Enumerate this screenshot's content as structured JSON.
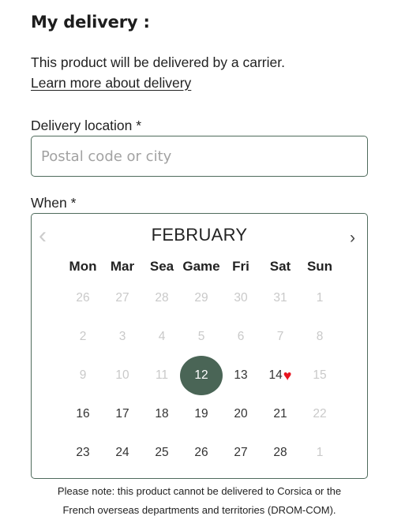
{
  "header": {
    "title": "My delivery :"
  },
  "intro": {
    "text": "This product will be delivered by a carrier.",
    "link": "Learn more about delivery"
  },
  "location": {
    "label": "Delivery location *",
    "placeholder": "Postal code or city",
    "value": ""
  },
  "when": {
    "label": "When *"
  },
  "calendar": {
    "month": "FEBRUARY",
    "prev_icon": "chevron-left-icon",
    "next_icon": "chevron-right-icon",
    "weekdays": [
      "Mon",
      "Mar",
      "Sea",
      "Game",
      "Fri",
      "Sat",
      "Sun"
    ],
    "weeks": [
      [
        {
          "d": "26",
          "s": "muted"
        },
        {
          "d": "27",
          "s": "muted"
        },
        {
          "d": "28",
          "s": "muted"
        },
        {
          "d": "29",
          "s": "muted"
        },
        {
          "d": "30",
          "s": "muted"
        },
        {
          "d": "31",
          "s": "muted"
        },
        {
          "d": "1",
          "s": "muted"
        }
      ],
      [
        {
          "d": "2",
          "s": "muted"
        },
        {
          "d": "3",
          "s": "muted"
        },
        {
          "d": "4",
          "s": "muted"
        },
        {
          "d": "5",
          "s": "muted"
        },
        {
          "d": "6",
          "s": "muted"
        },
        {
          "d": "7",
          "s": "muted"
        },
        {
          "d": "8",
          "s": "muted"
        }
      ],
      [
        {
          "d": "9",
          "s": "muted"
        },
        {
          "d": "10",
          "s": "muted"
        },
        {
          "d": "11",
          "s": "muted"
        },
        {
          "d": "12",
          "s": "selected"
        },
        {
          "d": "13",
          "s": "active"
        },
        {
          "d": "14",
          "s": "active",
          "heart": true
        },
        {
          "d": "15",
          "s": "muted"
        }
      ],
      [
        {
          "d": "16",
          "s": "active"
        },
        {
          "d": "17",
          "s": "active"
        },
        {
          "d": "18",
          "s": "active"
        },
        {
          "d": "19",
          "s": "active"
        },
        {
          "d": "20",
          "s": "active"
        },
        {
          "d": "21",
          "s": "active"
        },
        {
          "d": "22",
          "s": "muted"
        }
      ],
      [
        {
          "d": "23",
          "s": "active"
        },
        {
          "d": "24",
          "s": "active"
        },
        {
          "d": "25",
          "s": "active"
        },
        {
          "d": "26",
          "s": "active"
        },
        {
          "d": "27",
          "s": "active"
        },
        {
          "d": "28",
          "s": "active"
        },
        {
          "d": "1",
          "s": "muted"
        }
      ]
    ],
    "selected_color": "#4a6556",
    "heart_icon": "heart-icon",
    "heart_color": "#e8141f"
  },
  "note": {
    "line1": "Please note: this product cannot be delivered to Corsica or the",
    "line2": "French overseas departments and territories (DROM-COM)."
  },
  "colors": {
    "border": "#4f6b5c",
    "text": "#222222",
    "muted": "#c9c9c9"
  }
}
